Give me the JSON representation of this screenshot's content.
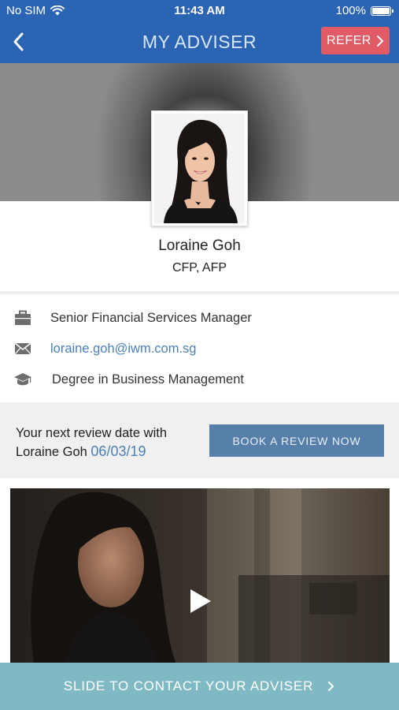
{
  "status_bar": {
    "carrier": "No SIM",
    "time": "11:43 AM",
    "battery": "100%",
    "wifi_icon": "wifi-icon",
    "battery_icon": "battery-icon"
  },
  "nav": {
    "title": "MY ADVISER",
    "back_icon": "chevron-left-icon",
    "refer_label": "REFER",
    "refer_icon": "chevron-right-icon"
  },
  "profile": {
    "name": "Loraine Goh",
    "qualifications": "CFP, AFP"
  },
  "details": {
    "role": "Senior Financial Services Manager",
    "role_icon": "briefcase-icon",
    "email": "loraine.goh@iwm.com.sg",
    "email_icon": "envelope-icon",
    "education": "Degree in Business Management",
    "education_icon": "graduation-cap-icon"
  },
  "review": {
    "text_line1": "Your next review date with",
    "text_line2": "Loraine Goh",
    "date": "06/03/19",
    "button_label": "BOOK A REVIEW NOW"
  },
  "video": {
    "play_icon": "play-icon"
  },
  "footer": {
    "slide_label": "SLIDE TO CONTACT YOUR ADVISER",
    "slide_icon": "chevron-right-icon"
  },
  "colors": {
    "primary_blue": "#2c64b4",
    "refer_red": "#e15b66",
    "book_button": "#567fa9",
    "link_blue": "#4b7fb8",
    "slide_bar": "#7fb9c3"
  }
}
